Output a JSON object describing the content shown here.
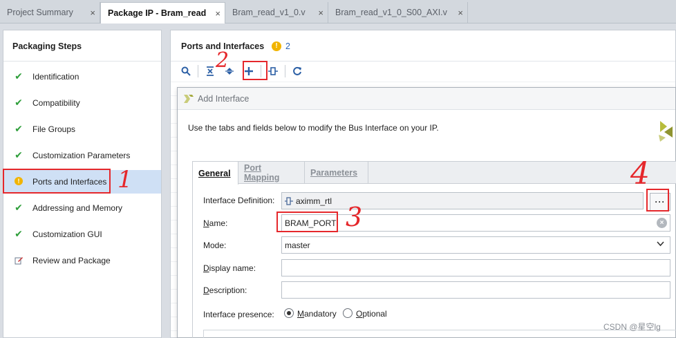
{
  "tabs": [
    {
      "label": "Project Summary",
      "active": false,
      "closable": true
    },
    {
      "label": "Package IP - Bram_read",
      "active": true,
      "closable": true
    },
    {
      "label": "Bram_read_v1_0.v",
      "active": false,
      "closable": true
    },
    {
      "label": "Bram_read_v1_0_S00_AXI.v",
      "active": false,
      "closable": true
    }
  ],
  "tab_close_glyph": "×",
  "sidebar": {
    "title": "Packaging Steps",
    "steps": [
      {
        "label": "Identification",
        "status": "check"
      },
      {
        "label": "Compatibility",
        "status": "check"
      },
      {
        "label": "File Groups",
        "status": "check"
      },
      {
        "label": "Customization Parameters",
        "status": "check"
      },
      {
        "label": "Ports and Interfaces",
        "status": "warning",
        "selected": true
      },
      {
        "label": "Addressing and Memory",
        "status": "check"
      },
      {
        "label": "Customization GUI",
        "status": "check"
      },
      {
        "label": "Review and Package",
        "status": "edit"
      }
    ]
  },
  "panel": {
    "title": "Ports and Interfaces",
    "warning_count": "2",
    "toolbar": [
      "search-icon",
      "collapse-all-icon",
      "expand-all-icon",
      "add-icon",
      "edit-port-icon",
      "refresh-icon"
    ]
  },
  "dialog": {
    "title": "Add Interface",
    "description": "Use the tabs and fields below to modify the Bus Interface on your IP.",
    "tabs": [
      {
        "label": "General",
        "active": true
      },
      {
        "label": "Port Mapping",
        "active": false
      },
      {
        "label": "Parameters",
        "active": false
      }
    ],
    "fields": {
      "interface_definition": {
        "label": "Interface Definition:",
        "value": "aximm_rtl"
      },
      "name": {
        "label": "Name:",
        "value": "BRAM_PORT"
      },
      "mode": {
        "label": "Mode:",
        "value": "master"
      },
      "display_name": {
        "label": "Display name:",
        "value": ""
      },
      "description": {
        "label": "Description:",
        "value": ""
      },
      "presence": {
        "label": "Interface presence:",
        "options": [
          "Mandatory",
          "Optional"
        ],
        "selected": "Mandatory"
      }
    },
    "browse_label": "···"
  },
  "annotations": [
    "1",
    "2",
    "3",
    "4"
  ],
  "watermark": "CSDN @星空lg",
  "colors": {
    "accent": "#2b5fa5",
    "check": "#2e9e3a",
    "warning": "#f1b400",
    "annotation": "#e5272b",
    "selected": "#cfe0f5"
  }
}
